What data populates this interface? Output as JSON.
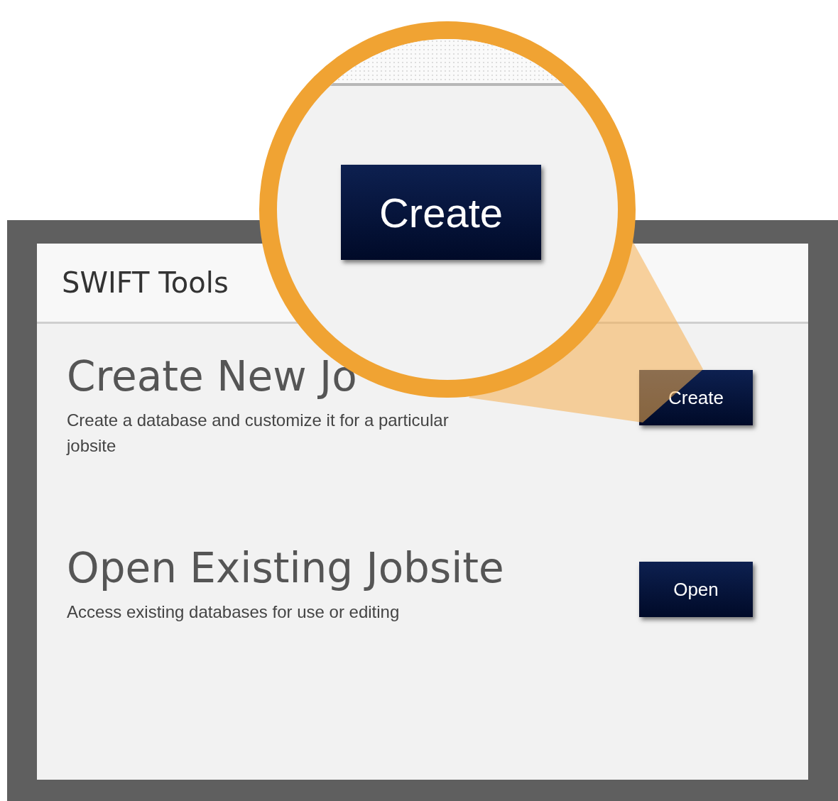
{
  "app": {
    "title": "SWIFT Tools"
  },
  "actions": [
    {
      "title": "Create New Jo",
      "description": "Create a database and customize it for a particular jobsite",
      "button": "Create"
    },
    {
      "title": "Open Existing Jobsite",
      "description": "Access existing databases for use or editing",
      "button": "Open"
    }
  ],
  "magnifier": {
    "button": "Create"
  }
}
